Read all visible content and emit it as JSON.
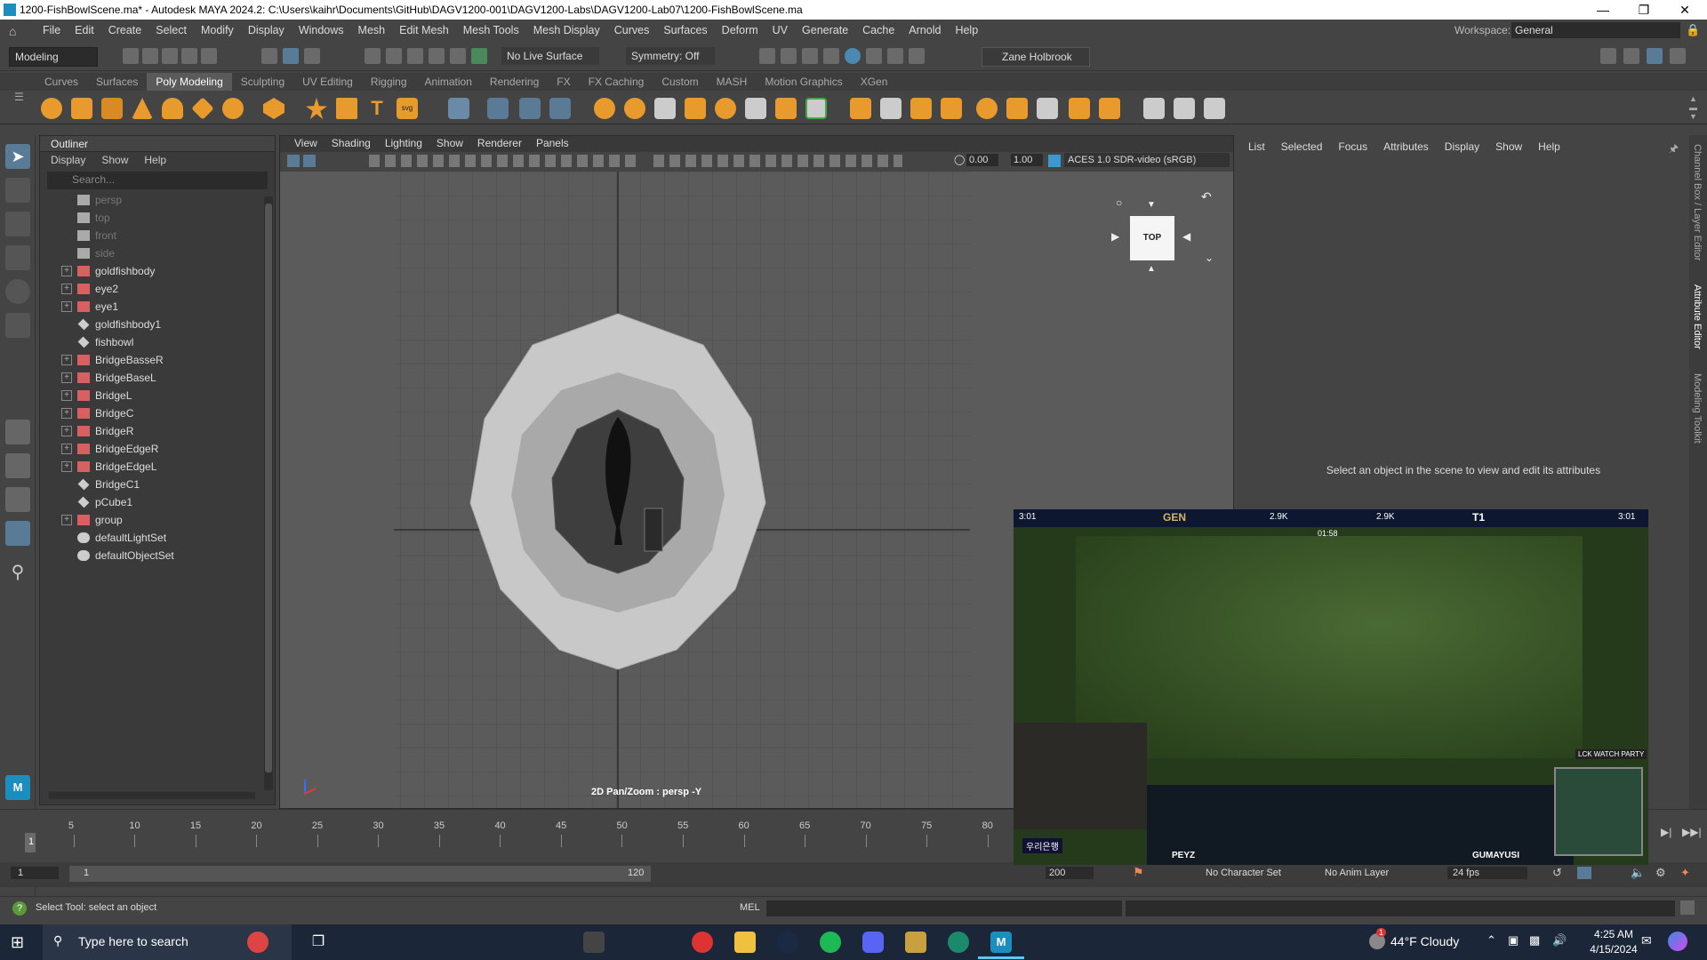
{
  "window": {
    "title": "1200-FishBowlScene.ma* - Autodesk MAYA 2024.2: C:\\Users\\kaihr\\Documents\\GitHub\\DAGV1200-001\\DAGV1200-Labs\\DAGV1200-Lab07\\1200-FishBowlScene.ma"
  },
  "menu": [
    "File",
    "Edit",
    "Create",
    "Select",
    "Modify",
    "Display",
    "Windows",
    "Mesh",
    "Edit Mesh",
    "Mesh Tools",
    "Mesh Display",
    "Curves",
    "Surfaces",
    "Deform",
    "UV",
    "Generate",
    "Cache",
    "Arnold",
    "Help"
  ],
  "workspace": {
    "label": "Workspace:",
    "value": "General"
  },
  "status_line": {
    "menuset": "Modeling",
    "live_surface": "No Live Surface",
    "symmetry": "Symmetry: Off",
    "user": "Zane Holbrook"
  },
  "shelf_tabs": [
    "Curves",
    "Surfaces",
    "Poly Modeling",
    "Sculpting",
    "UV Editing",
    "Rigging",
    "Animation",
    "Rendering",
    "FX",
    "FX Caching",
    "Custom",
    "MASH",
    "Motion Graphics",
    "XGen"
  ],
  "shelf_active": "Poly Modeling",
  "outliner": {
    "title": "Outliner",
    "menu": [
      "Display",
      "Show",
      "Help"
    ],
    "search_placeholder": "Search...",
    "items": [
      {
        "label": "persp",
        "type": "camera",
        "expandable": false,
        "dim": true
      },
      {
        "label": "top",
        "type": "camera",
        "expandable": false,
        "dim": true
      },
      {
        "label": "front",
        "type": "camera",
        "expandable": false,
        "dim": true
      },
      {
        "label": "side",
        "type": "camera",
        "expandable": false,
        "dim": true
      },
      {
        "label": "goldfishbody",
        "type": "mesh",
        "expandable": true,
        "dim": false
      },
      {
        "label": "eye2",
        "type": "mesh",
        "expandable": true,
        "dim": false
      },
      {
        "label": "eye1",
        "type": "mesh",
        "expandable": true,
        "dim": false
      },
      {
        "label": "goldfishbody1",
        "type": "transform",
        "expandable": false,
        "dim": false
      },
      {
        "label": "fishbowl",
        "type": "transform",
        "expandable": false,
        "dim": false
      },
      {
        "label": "BridgeBasseR",
        "type": "mesh",
        "expandable": true,
        "dim": false
      },
      {
        "label": "BridgeBaseL",
        "type": "mesh",
        "expandable": true,
        "dim": false
      },
      {
        "label": "BridgeL",
        "type": "mesh",
        "expandable": true,
        "dim": false
      },
      {
        "label": "BridgeC",
        "type": "mesh",
        "expandable": true,
        "dim": false
      },
      {
        "label": "BridgeR",
        "type": "mesh",
        "expandable": true,
        "dim": false
      },
      {
        "label": "BridgeEdgeR",
        "type": "mesh",
        "expandable": true,
        "dim": false
      },
      {
        "label": "BridgeEdgeL",
        "type": "mesh",
        "expandable": true,
        "dim": false
      },
      {
        "label": "BridgeC1",
        "type": "transform",
        "expandable": false,
        "dim": false
      },
      {
        "label": "pCube1",
        "type": "transform",
        "expandable": false,
        "dim": false
      },
      {
        "label": "group",
        "type": "mesh",
        "expandable": true,
        "dim": false
      },
      {
        "label": "defaultLightSet",
        "type": "set",
        "expandable": false,
        "dim": false
      },
      {
        "label": "defaultObjectSet",
        "type": "set",
        "expandable": false,
        "dim": false
      }
    ]
  },
  "viewport": {
    "menu": [
      "View",
      "Shading",
      "Lighting",
      "Show",
      "Renderer",
      "Panels"
    ],
    "field1": "0.00",
    "field2": "1.00",
    "color_space": "ACES 1.0 SDR-video (sRGB)",
    "hud_text": "2D Pan/Zoom : persp -Y",
    "viewcube_label": "TOP"
  },
  "attribute_editor": {
    "tabs": [
      "List",
      "Selected",
      "Focus",
      "Attributes",
      "Display",
      "Show",
      "Help"
    ],
    "message": "Select an object in the scene to view and edit its attributes"
  },
  "side_tabs": [
    "Channel Box / Layer Editor",
    "Attribute Editor",
    "Modeling Toolkit"
  ],
  "timeline": {
    "ticks": [
      "5",
      "10",
      "15",
      "20",
      "25",
      "30",
      "35",
      "40",
      "45",
      "50",
      "55",
      "60",
      "65",
      "70",
      "75",
      "80"
    ],
    "current_frame_label": "1",
    "start": "1",
    "range_start": "1",
    "range_end_label": "120",
    "end": "200",
    "character_set": "No Character Set",
    "anim_layer": "No Anim Layer",
    "fps": "24 fps"
  },
  "help_line": {
    "text": "Select Tool: select an object",
    "mel_label": "MEL"
  },
  "overlay_video": {
    "top_left_time": "3:01",
    "team_left": "GEN",
    "team_right": "T1",
    "top_right_time": "3:01",
    "kills_left": "2.9K",
    "kills_right": "2.9K",
    "clock": "01:58",
    "player_left": "PEYZ",
    "player_right": "GUMAYUSI",
    "badge": "LCK WATCH PARTY",
    "sponsor": "우리은행"
  },
  "taskbar": {
    "search_placeholder": "Type here to search",
    "weather": "44°F  Cloudy",
    "time": "4:25 AM",
    "date": "4/15/2024",
    "notification_count": "1"
  },
  "colors": {
    "bg": "#444444",
    "viewport": "#5b5b5b",
    "accent": "#5ac8f0",
    "taskbar": "#1b2638",
    "shelf_orange": "#e89a2c"
  }
}
